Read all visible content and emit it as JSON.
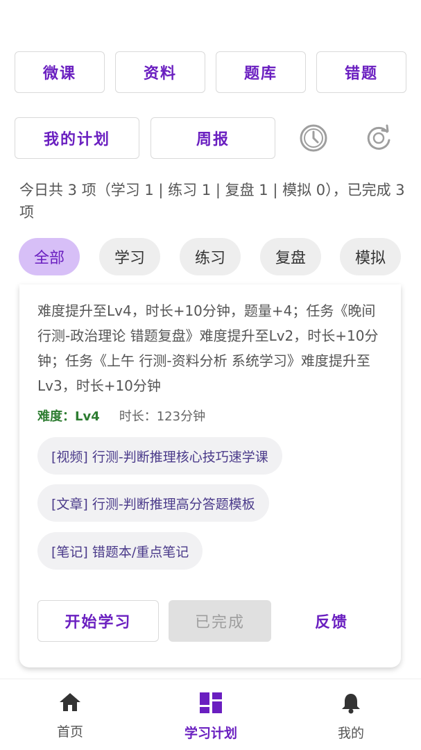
{
  "top_buttons": [
    "微课",
    "资料",
    "题库",
    "错题"
  ],
  "second_row": {
    "plan_label": "我的计划",
    "weekly_label": "周报",
    "history_icon": "clock-history-icon",
    "refresh_icon": "refresh-icon"
  },
  "summary": "今日共 3 项（学习 1 | 练习 1 | 复盘 1 | 模拟 0），已完成 3 项",
  "filters": [
    "全部",
    "学习",
    "练习",
    "复盘",
    "模拟"
  ],
  "active_filter": "全部",
  "task_card": {
    "description": "难度提升至Lv4，时长+10分钟，题量+4；任务《晚间 行测-政治理论 错题复盘》难度提升至Lv2，时长+10分钟；任务《上午 行测-资料分析 系统学习》难度提升至Lv3，时长+10分钟",
    "difficulty": "难度：Lv4",
    "duration": "时长：123分钟",
    "resources": [
      "[视频] 行测-判断推理核心技巧速学课",
      "[文章] 行测-判断推理高分答题模板",
      "[笔记] 错题本/重点笔记"
    ],
    "start_label": "开始学习",
    "done_label": "已完成",
    "feedback_label": "反馈"
  },
  "bottom_nav": [
    {
      "label": "首页",
      "icon": "home-icon"
    },
    {
      "label": "学习计划",
      "icon": "dashboard-icon"
    },
    {
      "label": "我的",
      "icon": "bell-icon"
    }
  ],
  "colors": {
    "accent": "#6a1fc0",
    "chip_active_bg": "#d7bff7",
    "difficulty_green": "#2e7d32"
  }
}
